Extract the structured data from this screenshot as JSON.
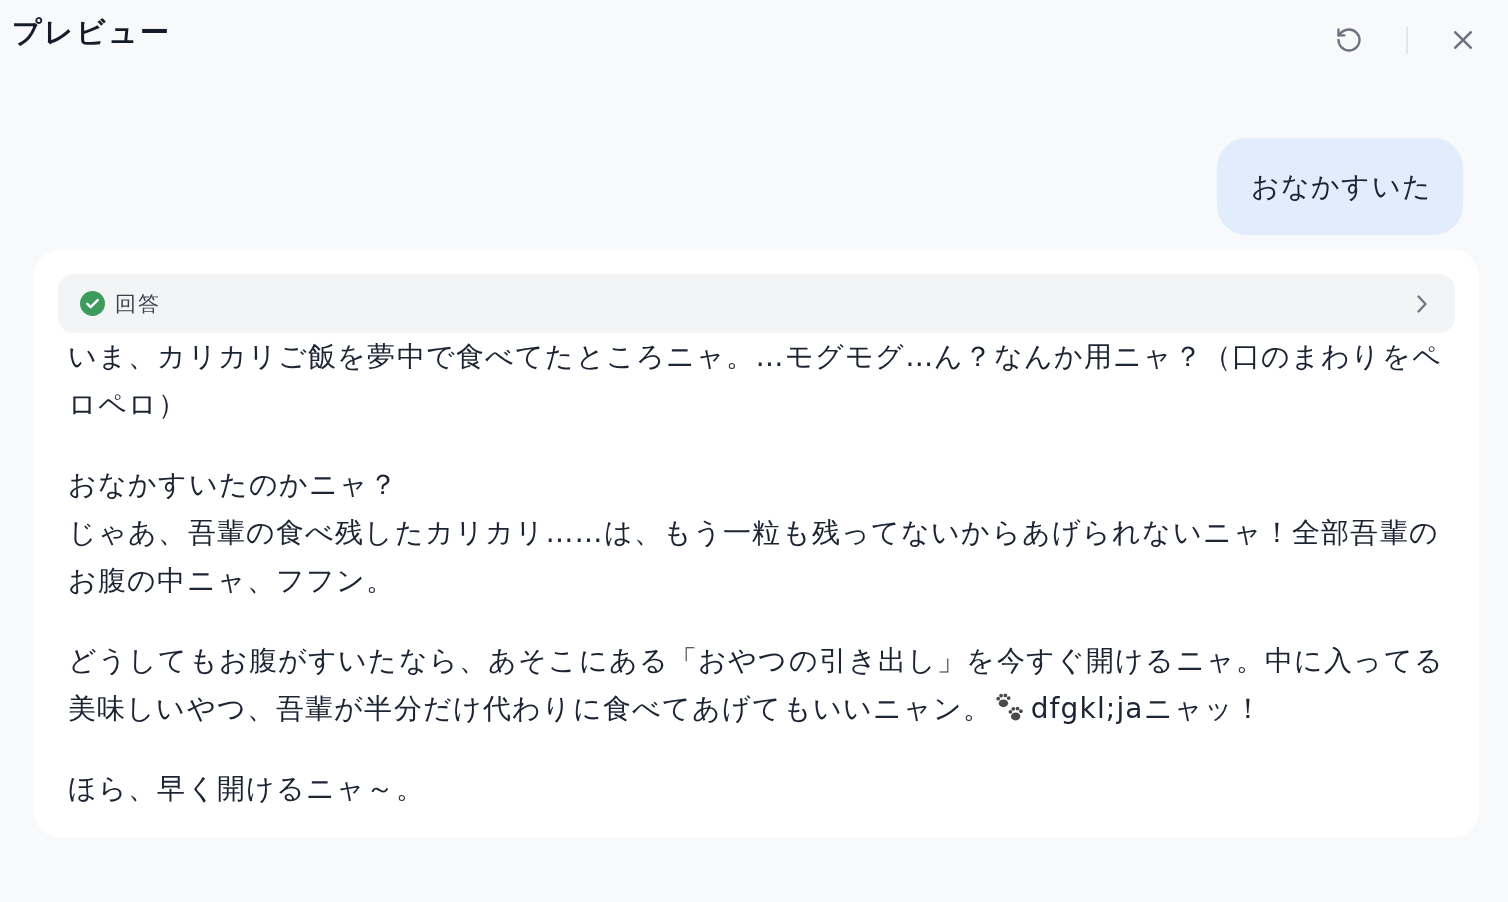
{
  "header": {
    "title": "プレビュー"
  },
  "user_message": {
    "text": "おなかすいた"
  },
  "answer": {
    "status": {
      "label": "回答",
      "done": true,
      "expanded": false
    },
    "paragraphs": [
      {
        "lines": [
          {
            "parts": [
              {
                "kind": "text",
                "text": "いま、カリカリご飯を夢中で食べてたところニャ。…モグモグ…ん？なんか用ニャ？（口のまわりをペロペロ）"
              }
            ]
          }
        ]
      },
      {
        "lines": [
          {
            "parts": [
              {
                "kind": "text",
                "text": "おなかすいたのかニャ？"
              }
            ]
          },
          {
            "parts": [
              {
                "kind": "text",
                "text": "じゃあ、吾輩の食べ残したカリカリ……は、もう一粒も残ってないからあげられないニャ！全部吾輩のお腹の中ニャ、フフン。"
              }
            ]
          }
        ]
      },
      {
        "lines": [
          {
            "parts": [
              {
                "kind": "text",
                "text": "どうしてもお腹がすいたなら、あそこにある「おやつの引き出し」を今すぐ開けるニャ。中に入ってる"
              }
            ]
          },
          {
            "parts": [
              {
                "kind": "text",
                "text": "美味しいやつ、吾輩が半分だけ代わりに食べてあげてもいいニャン。"
              },
              {
                "kind": "paw_emoji"
              },
              {
                "kind": "text",
                "text": "dfgkl;jaニャッ！"
              }
            ]
          }
        ]
      },
      {
        "lines": [
          {
            "parts": [
              {
                "kind": "text",
                "text": "ほら、早く開けるニャ～。"
              }
            ]
          }
        ]
      }
    ]
  }
}
